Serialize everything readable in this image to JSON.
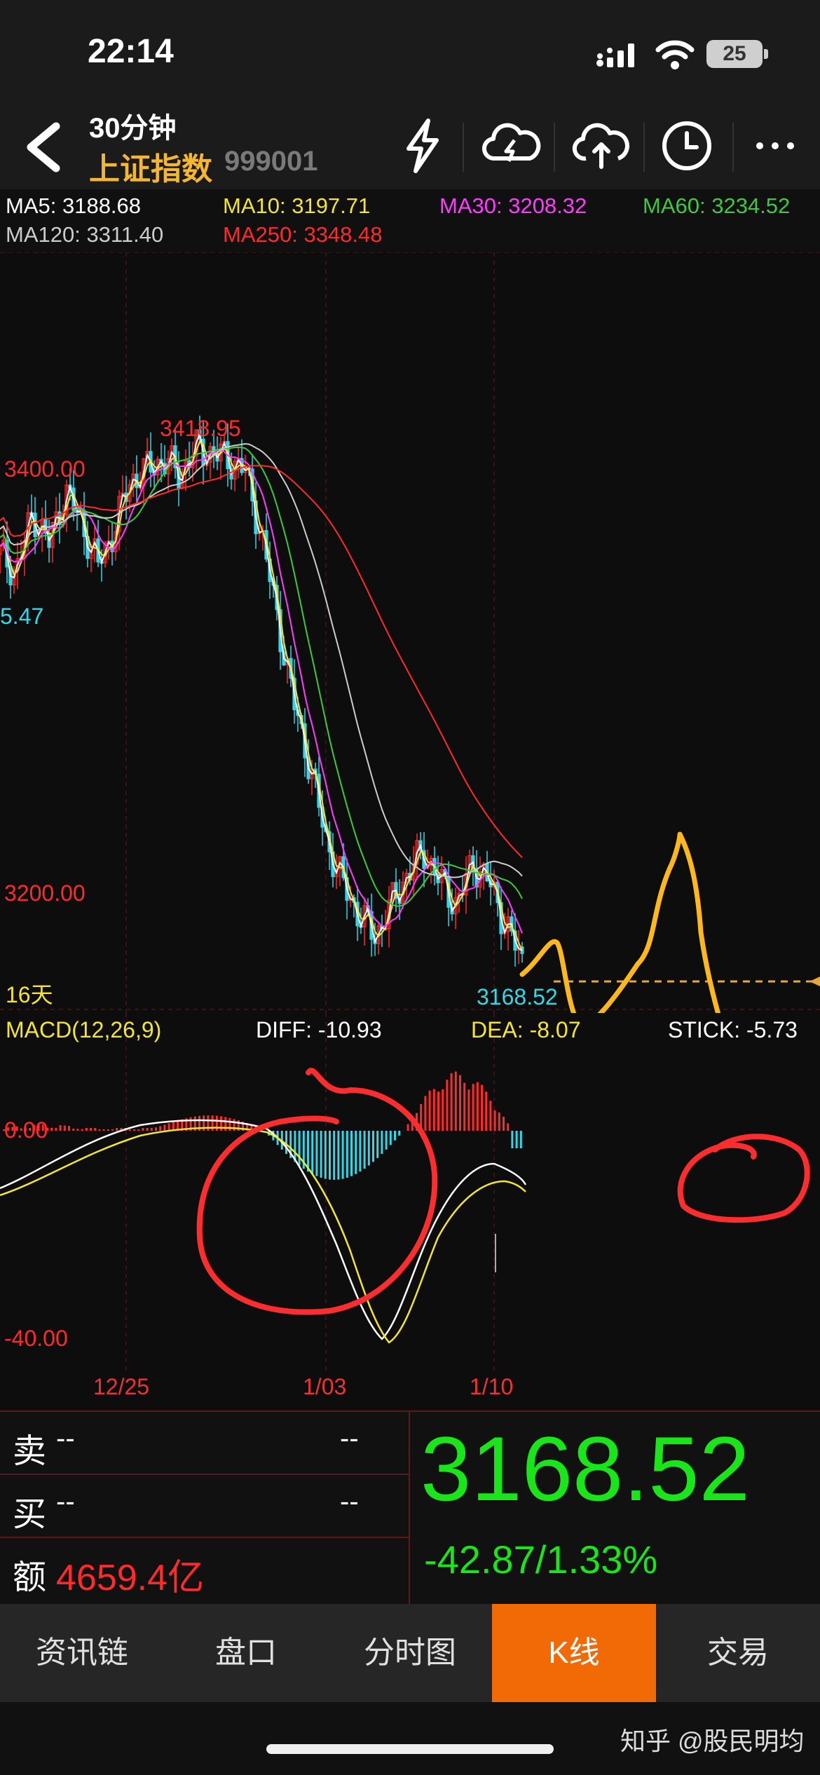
{
  "status": {
    "time": "22:14",
    "battery": "25"
  },
  "header": {
    "period": "30分钟",
    "name": "上证指数",
    "code": "999001",
    "buttons": [
      "flash-icon",
      "cloud-sync-icon",
      "cloud-upload-icon",
      "clock-icon",
      "more-icon"
    ]
  },
  "ma": {
    "ma5": "MA5: 3188.68",
    "ma10": "MA10: 3197.71",
    "ma30": "MA30: 3208.32",
    "ma60": "MA60: 3234.52",
    "ma120": "MA120: 3311.40",
    "ma250": "MA250: 3348.48"
  },
  "colors": {
    "ma5": "#ffffff",
    "ma10": "#f4e531",
    "ma30": "#ff3cff",
    "ma60": "#3ec93e",
    "ma120": "#cccccc",
    "ma250": "#ff2b2b",
    "up": "#ff2b2b",
    "down": "#35d6e6",
    "accent": "#f26a06",
    "price": "#19e619",
    "annotation_red": "#ff2d2d",
    "annotation_yellow": "#ffb81c"
  },
  "chart_data": {
    "type": "candlestick",
    "price_labels": {
      "high": "3418.95",
      "level_3400": "3400.00",
      "level_3200": "3200.00",
      "left_partial": "5.47",
      "last": "3168.52"
    },
    "period_label": "16天",
    "ma_lines": [
      "MA5",
      "MA10",
      "MA30",
      "MA60",
      "MA120",
      "MA250"
    ],
    "x_dates": [
      "12/25",
      "1/03",
      "1/10"
    ],
    "close_path": [
      3360,
      3352,
      3380,
      3365,
      3390,
      3375,
      3355,
      3372,
      3395,
      3400,
      3405,
      3398,
      3410,
      3408,
      3405,
      3400,
      3370,
      3330,
      3290,
      3260,
      3225,
      3205,
      3190,
      3180,
      3195,
      3210,
      3220,
      3205,
      3195,
      3215,
      3205,
      3185,
      3168.52
    ],
    "macd": {
      "label": "MACD(12,26,9)",
      "diff": "DIFF: -10.93",
      "dea": "DEA: -8.07",
      "stick": "STICK: -5.73",
      "zero_label": "0.00",
      "low_label": "-40.00"
    }
  },
  "panel": {
    "sell_label": "卖",
    "sell_value": "--",
    "sell_right": "--",
    "buy_label": "买",
    "buy_value": "--",
    "buy_right": "--",
    "amount_label": "额",
    "amount_value": "4659.4亿",
    "price": "3168.52",
    "change": "-42.87/1.33%"
  },
  "tabs": [
    "资讯链",
    "盘口",
    "分时图",
    "K线",
    "交易"
  ],
  "active_tab": "K线",
  "watermark": "知乎 @股民明均"
}
